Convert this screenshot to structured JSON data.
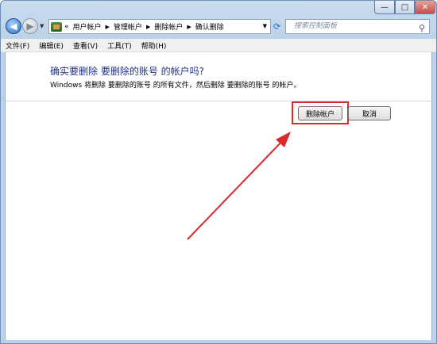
{
  "window": {
    "caption_buttons": {
      "minimize": "—",
      "maximize": "□",
      "close": "✕"
    }
  },
  "nav": {
    "back_glyph": "◀",
    "forward_glyph": "▶",
    "breadcrumb_prefix": "«",
    "breadcrumbs": [
      "用户帐户",
      "管理帐户",
      "删除帐户",
      "确认删除"
    ],
    "search_placeholder": "搜索控制面板"
  },
  "menubar": {
    "items": [
      "文件(F)",
      "编辑(E)",
      "查看(V)",
      "工具(T)",
      "帮助(H)"
    ]
  },
  "content": {
    "heading": "确实要删除 要删除的账号 的帐户吗?",
    "description": "Windows 将删除 要删除的账号 的所有文件，然后删除 要删除的账号 的帐户。",
    "delete_button": "删除帐户",
    "cancel_button": "取消"
  },
  "colors": {
    "heading": "#1e3287",
    "annotation": "#d92b2b"
  }
}
